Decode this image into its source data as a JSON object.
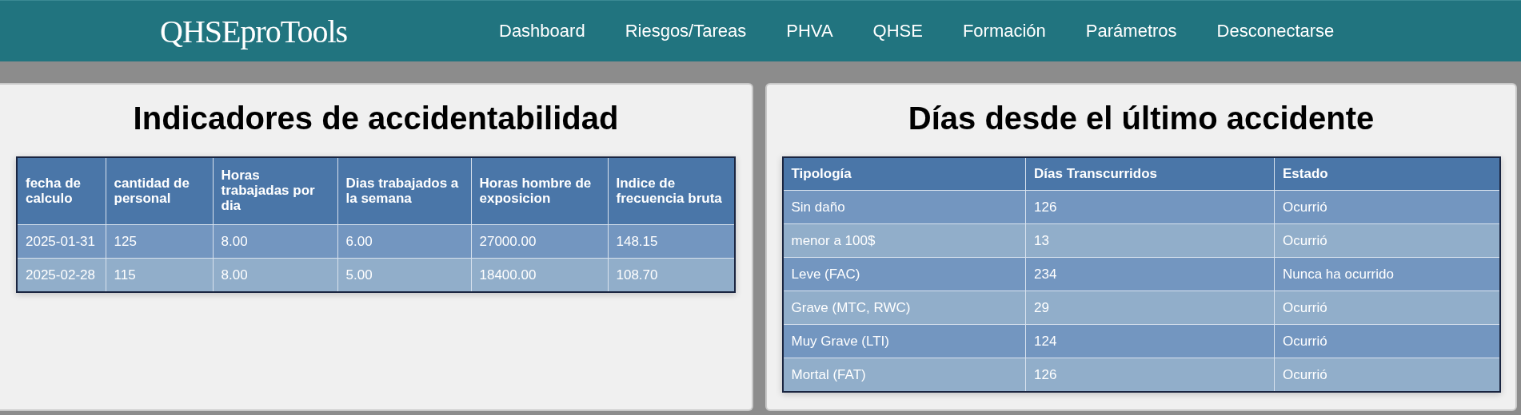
{
  "header": {
    "logo": "QHSEproTools",
    "nav": [
      "Dashboard",
      "Riesgos/Tareas",
      "PHVA",
      "QHSE",
      "Formación",
      "Parámetros",
      "Desconectarse"
    ]
  },
  "panels": [
    {
      "title": "Indicadores de accidentabilidad",
      "columns": [
        "fecha de calculo",
        "cantidad de personal",
        "Horas trabajadas por dia",
        "Dias trabajados a la semana",
        "Horas hombre de exposicion",
        "Indice de frecuencia bruta"
      ],
      "rows": [
        [
          "2025-01-31",
          "125",
          "8.00",
          "6.00",
          "27000.00",
          "148.15"
        ],
        [
          "2025-02-28",
          "115",
          "8.00",
          "5.00",
          "18400.00",
          "108.70"
        ]
      ]
    },
    {
      "title": "Días desde el último accidente",
      "columns": [
        "Tipología",
        "Días Transcurridos",
        "Estado"
      ],
      "rows": [
        [
          "Sin daño",
          "126",
          "Ocurrió"
        ],
        [
          "menor a 100$",
          "13",
          "Ocurrió"
        ],
        [
          "Leve (FAC)",
          "234",
          "Nunca ha ocurrido"
        ],
        [
          "Grave (MTC, RWC)",
          "29",
          "Ocurrió"
        ],
        [
          "Muy Grave (LTI)",
          "124",
          "Ocurrió"
        ],
        [
          "Mortal (FAT)",
          "126",
          "Ocurrió"
        ]
      ]
    }
  ]
}
